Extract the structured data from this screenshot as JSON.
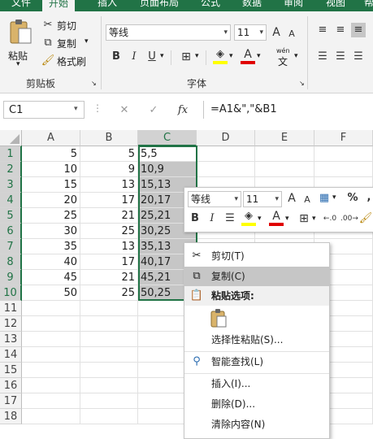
{
  "ribbon_tabs": [
    "文件",
    "开始",
    "插入",
    "页面布局",
    "公式",
    "数据",
    "审阅",
    "视图",
    "帮"
  ],
  "clipboard": {
    "paste": "粘贴",
    "cut": "剪切",
    "copy": "复制",
    "format_painter": "格式刷",
    "group_label": "剪贴板"
  },
  "font": {
    "name": "等线",
    "size": "11",
    "group_label": "字体",
    "bold": "B",
    "italic": "I",
    "underline": "U",
    "wen": "wén",
    "wen_char": "文",
    "grow": "A",
    "shrink": "A"
  },
  "formula_bar": {
    "name_box": "C1",
    "fx": "fx",
    "formula": "=A1&\",\"&B1"
  },
  "columns": [
    "A",
    "B",
    "C",
    "D",
    "E",
    "F"
  ],
  "rows": [
    {
      "n": "1",
      "a": "5",
      "b": "5",
      "c": "5,5"
    },
    {
      "n": "2",
      "a": "10",
      "b": "9",
      "c": "10,9"
    },
    {
      "n": "3",
      "a": "15",
      "b": "13",
      "c": "15,13"
    },
    {
      "n": "4",
      "a": "20",
      "b": "17",
      "c": "20,17"
    },
    {
      "n": "5",
      "a": "25",
      "b": "21",
      "c": "25,21"
    },
    {
      "n": "6",
      "a": "30",
      "b": "25",
      "c": "30,25"
    },
    {
      "n": "7",
      "a": "35",
      "b": "13",
      "c": "35,13"
    },
    {
      "n": "8",
      "a": "40",
      "b": "17",
      "c": "40,17"
    },
    {
      "n": "9",
      "a": "45",
      "b": "21",
      "c": "45,21"
    },
    {
      "n": "10",
      "a": "50",
      "b": "25",
      "c": "50,25"
    },
    {
      "n": "11",
      "a": "",
      "b": "",
      "c": ""
    },
    {
      "n": "12",
      "a": "",
      "b": "",
      "c": ""
    },
    {
      "n": "13",
      "a": "",
      "b": "",
      "c": ""
    },
    {
      "n": "14",
      "a": "",
      "b": "",
      "c": ""
    },
    {
      "n": "15",
      "a": "",
      "b": "",
      "c": ""
    },
    {
      "n": "16",
      "a": "",
      "b": "",
      "c": ""
    },
    {
      "n": "17",
      "a": "",
      "b": "",
      "c": ""
    },
    {
      "n": "18",
      "a": "",
      "b": "",
      "c": ""
    }
  ],
  "mini_toolbar": {
    "font_name": "等线",
    "font_size": "11",
    "bold": "B",
    "italic": "I",
    "percent": "%",
    "comma": ","
  },
  "context_menu": {
    "cut": "剪切(T)",
    "copy": "复制(C)",
    "paste_options": "粘贴选项:",
    "paste_special": "选择性粘贴(S)...",
    "smart_lookup": "智能查找(L)",
    "insert": "插入(I)...",
    "delete": "删除(D)...",
    "clear_contents": "清除内容(N)"
  },
  "colors": {
    "excel_green": "#217346",
    "selection_gray": "#c6c6c6",
    "font_color_red": "#e00000",
    "highlight_yellow": "#ffff00"
  }
}
